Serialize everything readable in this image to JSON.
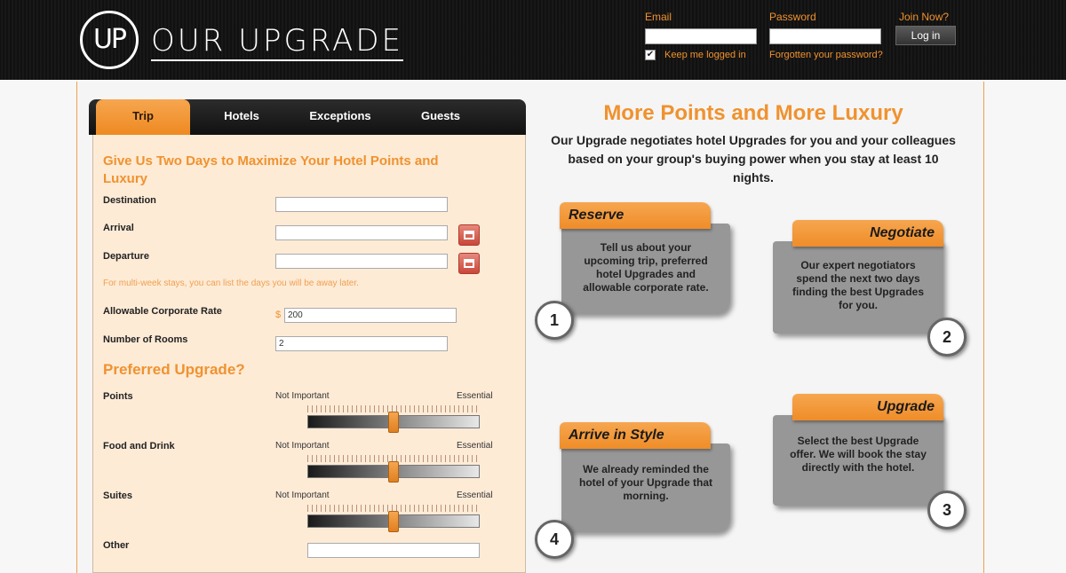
{
  "brand": {
    "logo_mark": "UP",
    "logo_text": "OUR UPGRADE"
  },
  "login": {
    "email_label": "Email",
    "email_value": "",
    "password_label": "Password",
    "password_value": "",
    "join_label": "Join Now?",
    "login_button": "Log in",
    "remember_checked": true,
    "remember_mark": "✔",
    "remember_label": "Keep me logged in",
    "forgot_label": "Forgotten your password?"
  },
  "tabs": [
    {
      "label": "Trip",
      "active": true
    },
    {
      "label": "Hotels",
      "active": false
    },
    {
      "label": "Exceptions",
      "active": false
    },
    {
      "label": "Guests",
      "active": false
    }
  ],
  "form": {
    "title": "Give Us Two Days to Maximize Your Hotel Points and Luxury",
    "destination_label": "Destination",
    "destination_value": "",
    "arrival_label": "Arrival",
    "arrival_value": "",
    "departure_label": "Departure",
    "departure_value": "",
    "hint": "For multi-week stays, you can list the days you will be away later.",
    "rate_label": "Allowable Corporate Rate",
    "rate_currency": "$",
    "rate_value": "200",
    "rooms_label": "Number of Rooms",
    "rooms_value": "2",
    "preferred_title": "Preferred Upgrade?",
    "scale_min_label": "Not Important",
    "scale_max_label": "Essential",
    "sliders": [
      {
        "label": "Points",
        "level": 0.5
      },
      {
        "label": "Food and Drink",
        "level": 0.5
      },
      {
        "label": "Suites",
        "level": 0.5
      }
    ],
    "other_label": "Other",
    "other_value": ""
  },
  "info": {
    "headline": "More Points and More Luxury",
    "subline": "Our Upgrade negotiates hotel Upgrades for you and your colleagues based on your group's buying power when you stay at least 10 nights.",
    "steps": [
      {
        "title": "Reserve",
        "text": "Tell us about your upcoming trip, preferred hotel Upgrades and allowable corporate rate.",
        "number": "1"
      },
      {
        "title": "Negotiate",
        "text": "Our expert negotiators spend the next two days finding the best Upgrades for you.",
        "number": "2"
      },
      {
        "title": "Upgrade",
        "text": "Select the best Upgrade offer. We will book the stay directly with the hotel.",
        "number": "3"
      },
      {
        "title": "Arrive in Style",
        "text": "We already reminded the hotel of your Upgrade that morning.",
        "number": "4"
      }
    ]
  },
  "colors": {
    "accent": "#f0922f",
    "header_bg": "#111111",
    "form_bg": "#fdebd6",
    "card_bg": "#979797"
  }
}
